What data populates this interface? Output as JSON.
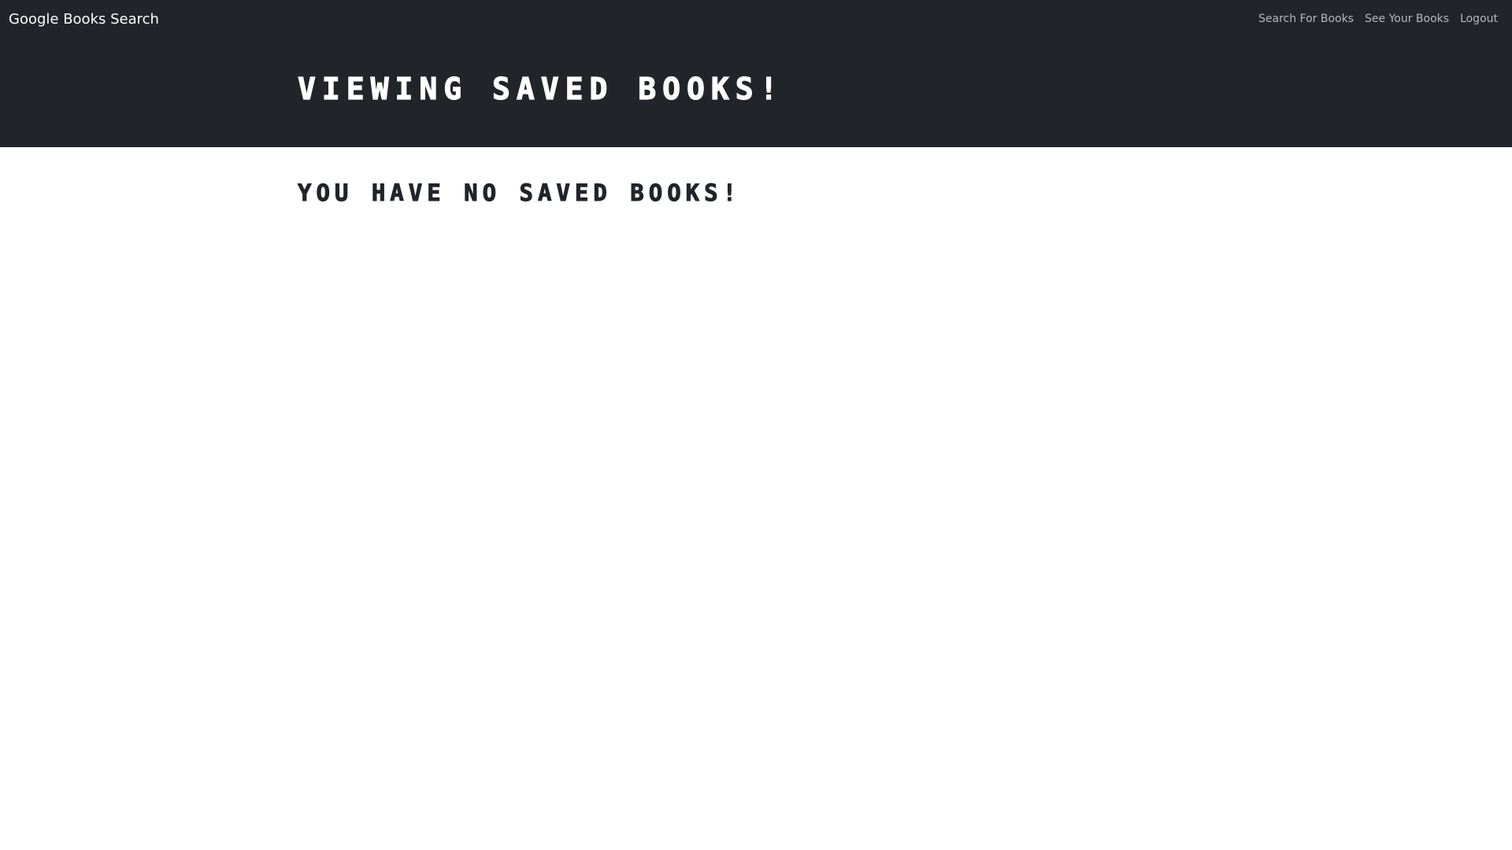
{
  "navbar": {
    "brand": "Google Books Search",
    "links": [
      {
        "label": "Search For Books"
      },
      {
        "label": "See Your Books"
      },
      {
        "label": "Logout"
      }
    ]
  },
  "hero": {
    "title": "Viewing saved books!"
  },
  "main": {
    "empty_message": "You have no saved books!"
  },
  "colors": {
    "navbar_bg": "#212529",
    "nav_link": "#b7b8ba",
    "heading_dark": "#212529",
    "page_bg": "#ffffff"
  }
}
